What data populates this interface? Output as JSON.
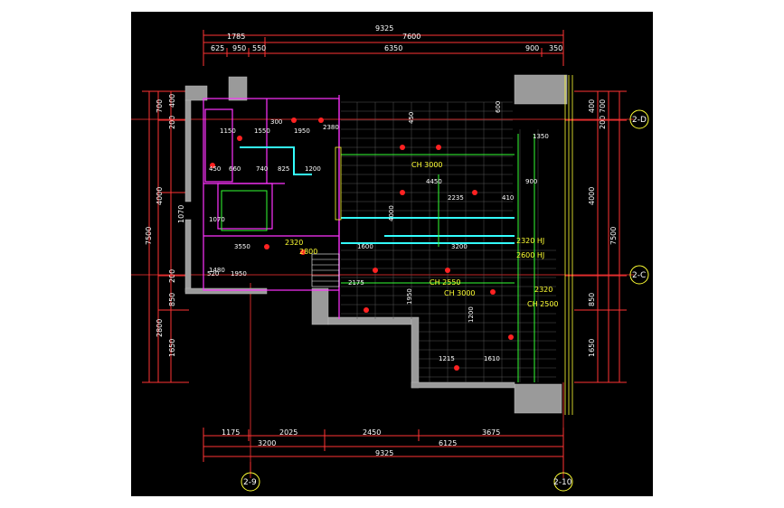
{
  "top_dims": {
    "overall": "9325",
    "row2": [
      "1785",
      "7600"
    ],
    "row3": [
      "625",
      "950",
      "550",
      "6350",
      "900",
      "350"
    ]
  },
  "bottom_dims": {
    "row1": [
      "1175",
      "2025",
      "2450",
      "3675"
    ],
    "row2": [
      "3200",
      "6125"
    ],
    "overall": "9325"
  },
  "left_dims": {
    "row1": [
      "700",
      "400",
      "4000",
      "1070",
      "850",
      "2800",
      "1650"
    ],
    "row2": [
      "7500"
    ],
    "extra": [
      "200",
      "200"
    ]
  },
  "right_dims": {
    "row1": [
      "400",
      "4000",
      "850",
      "1650"
    ],
    "extra": [
      "700",
      "200"
    ],
    "overall": "7500"
  },
  "axis_labels": {
    "top_right": "2-D",
    "mid_right": "2-C",
    "bottom_left": "2-9",
    "bottom_right": "2-10"
  },
  "annotations": [
    "1150",
    "1550",
    "1950",
    "2380",
    "300",
    "450",
    "660",
    "740",
    "825",
    "1200",
    "CH 3000",
    "4450",
    "2235",
    "410",
    "900",
    "1350",
    "1070",
    "3550",
    "2320",
    "2800",
    "1600",
    "3200",
    "2320 HJ",
    "2600 HJ",
    "1480",
    "2175",
    "CH 2550",
    "CH 3000",
    "2320",
    "CH 2500",
    "1215",
    "1610",
    "520",
    "1950",
    "450",
    "600",
    "4000",
    "1950",
    "1200"
  ]
}
